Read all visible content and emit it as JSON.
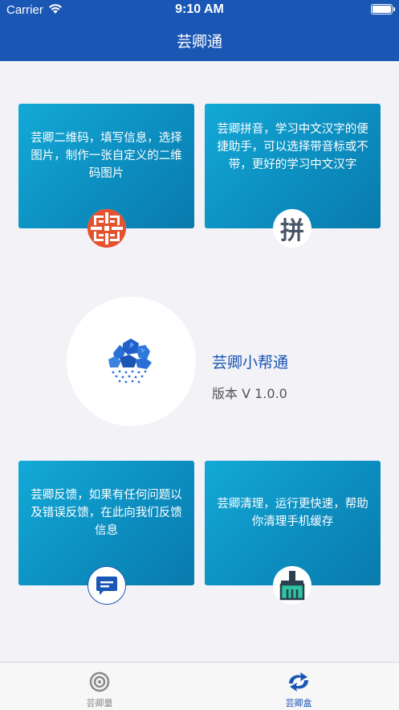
{
  "status_bar": {
    "carrier": "Carrier",
    "time": "9:10 AM"
  },
  "nav": {
    "title": "芸卿通"
  },
  "cards": [
    {
      "text": "芸卿二维码，填写信息，选择图片，制作一张自定义的二维码图片",
      "icon": "qr-code-icon"
    },
    {
      "text": "芸卿拼音，学习中文汉字的便捷助手，可以选择带音标或不带，更好的学习中文汉字",
      "icon": "pinyin-icon",
      "icon_char": "拼"
    },
    {
      "text": "芸卿反馈，如果有任何问题以及错误反馈，在此向我们反馈信息",
      "icon": "feedback-message-icon"
    },
    {
      "text": "芸卿清理，运行更快速，帮助你清理手机缓存",
      "icon": "broom-clean-icon"
    }
  ],
  "app_info": {
    "name": "芸卿小帮通",
    "version": "版本 V 1.0.0",
    "icon": "rain-cloud-logo-icon"
  },
  "tabs": [
    {
      "label": "芸卿量",
      "icon": "spiral-at-icon",
      "selected": false
    },
    {
      "label": "芸卿盒",
      "icon": "refresh-arrows-icon",
      "selected": true
    }
  ],
  "colors": {
    "primary": "#1a56b4",
    "card_start": "#13a9d6",
    "card_end": "#0a7aac",
    "qr_orange": "#e5512c",
    "broom_green": "#2ec4a0"
  }
}
